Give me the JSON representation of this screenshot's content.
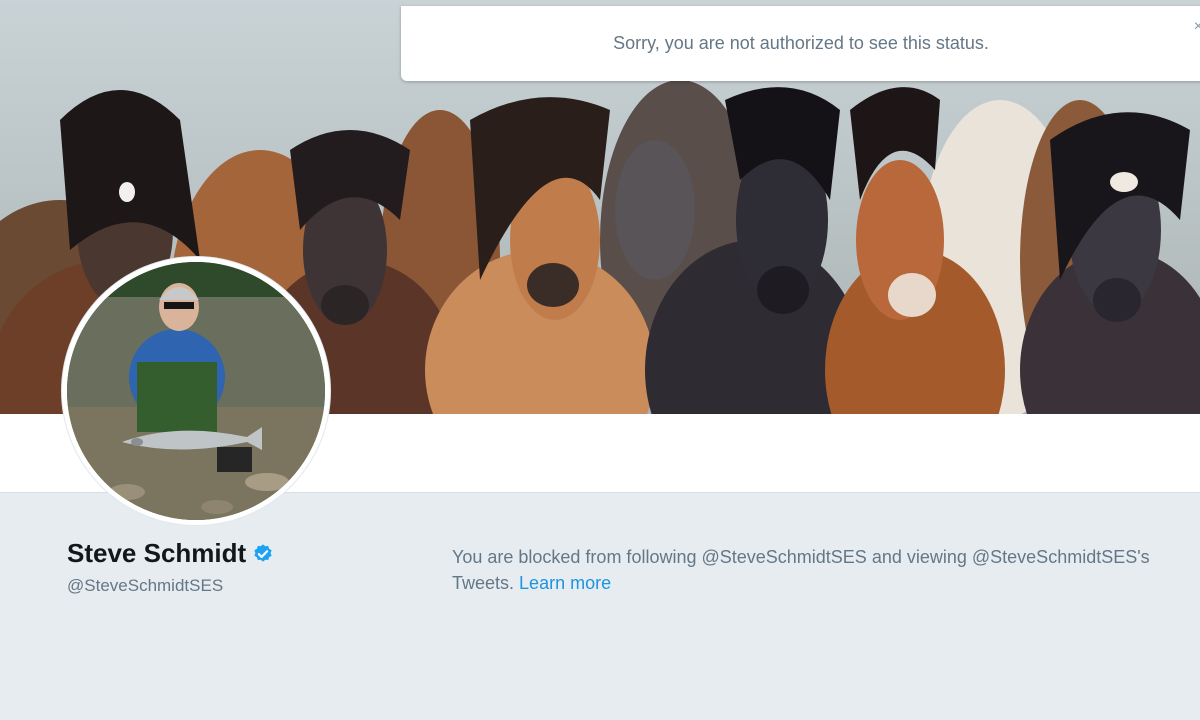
{
  "toast": {
    "message": "Sorry, you are not authorized to see this status.",
    "close_glyph": "×"
  },
  "profile": {
    "name": "Steve Schmidt",
    "handle": "@SteveSchmidtSES",
    "verified": true
  },
  "blocked_notice": {
    "text": "You are blocked from following @SteveSchmidtSES and viewing @SteveSchmidtSES's Tweets.",
    "link_label": "Learn more"
  },
  "colors": {
    "page_bg": "#e6ecf0",
    "link": "#1b95e0",
    "verified_badge": "#1da1f2",
    "muted_text": "#657786"
  },
  "icons": {
    "verified": "verified-badge-icon",
    "close": "close-icon"
  }
}
